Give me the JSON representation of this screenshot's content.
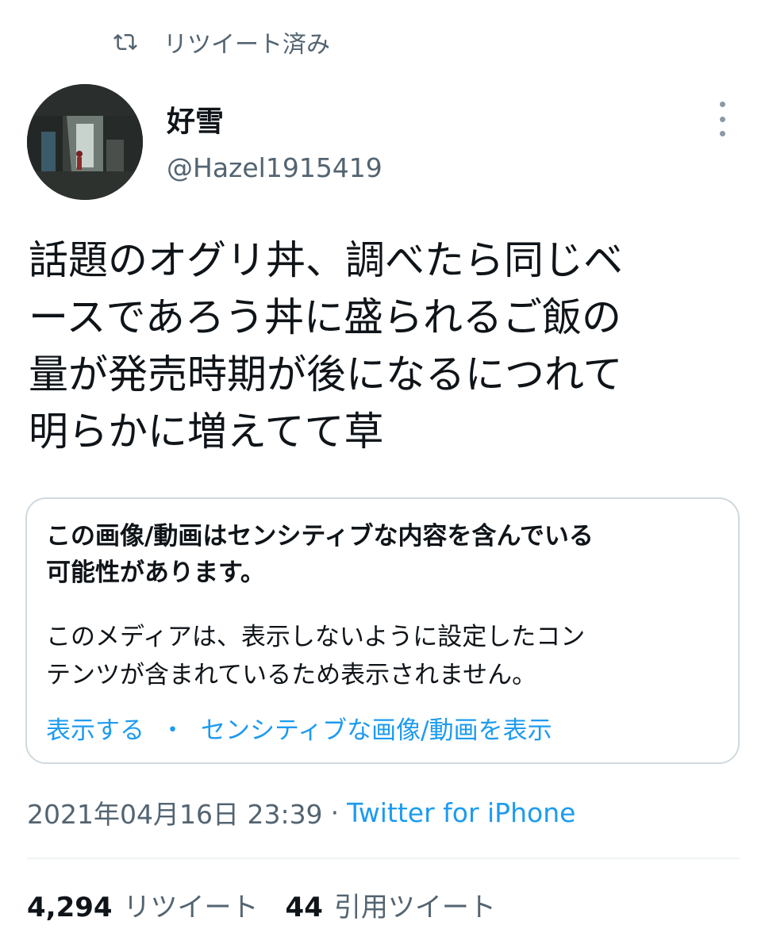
{
  "retweet_banner": {
    "label": "リツイート済み",
    "icon": "retweet-icon"
  },
  "author": {
    "display_name": "好雪",
    "handle": "@Hazel1915419",
    "avatar": "avatar-photo"
  },
  "tweet": {
    "text_lines": [
      "話題のオグリ丼、調べたら同じベ",
      "ースであろう丼に盛られるご飯の",
      "量が発売時期が後になるにつれて",
      "明らかに増えてて草"
    ]
  },
  "sensitive_notice": {
    "title_lines": [
      "この画像/動画はセンシティブな内容を含んでいる",
      "可能性があります。"
    ],
    "body_lines": [
      "このメディアは、表示しないように設定したコン",
      "テンツが含まれているため表示されません。"
    ],
    "show_link": "表示する",
    "separator": "・",
    "show_sensitive_link": "センシティブな画像/動画を表示"
  },
  "meta": {
    "timestamp": "2021年04月16日 23:39",
    "separator": "·",
    "source": "Twitter for iPhone"
  },
  "stats": {
    "retweets_count": "4,294",
    "retweets_label": "リツイート",
    "quotes_count": "44",
    "quotes_label": "引用ツイート"
  },
  "colors": {
    "accent": "#1d9bf0",
    "secondary_text": "#536471",
    "primary_text": "#0f1419",
    "border": "#cfd9de"
  }
}
